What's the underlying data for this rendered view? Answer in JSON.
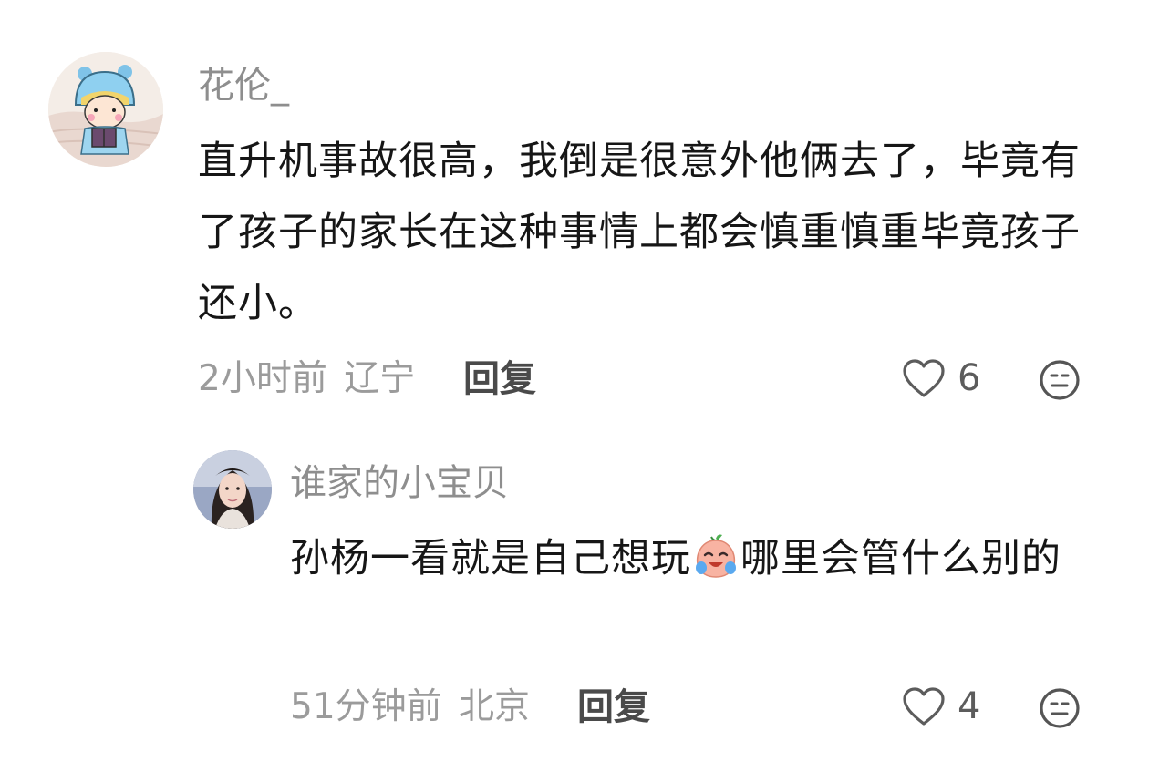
{
  "comments": [
    {
      "username": "花伦_",
      "content": "直升机事故很高，我倒是很意外他俩去了，毕竟有了孩子的家长在这种事情上都会慎重慎重毕竟孩子还小。",
      "time": "2小时前",
      "location": "辽宁",
      "reply_label": "回复",
      "likes": "6",
      "avatar_icon": "cartoon-boy-reading-avatar",
      "like_icon": "heart-outline-icon",
      "dislike_icon": "neutral-face-icon"
    },
    {
      "username": "谁家的小宝贝",
      "content_before": "孙杨一看就是自己想玩",
      "content_emoji": "crying-peach-emoji",
      "content_after": "哪里会管什么别的",
      "time": "51分钟前",
      "location": "北京",
      "reply_label": "回复",
      "likes": "4",
      "avatar_icon": "woman-portrait-avatar",
      "like_icon": "heart-outline-icon",
      "dislike_icon": "neutral-face-icon"
    }
  ],
  "colors": {
    "username": "#8e8e8e",
    "content": "#161616",
    "meta": "#9b9b9b",
    "reply": "#4a4a4a"
  }
}
